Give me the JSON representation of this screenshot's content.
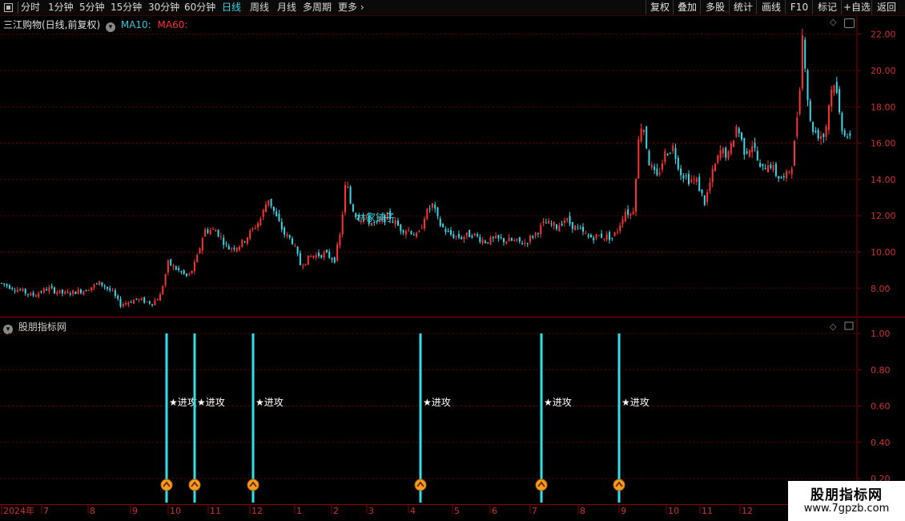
{
  "toolbar": {
    "periods": [
      {
        "label": "分时"
      },
      {
        "label": "1分钟"
      },
      {
        "label": "5分钟"
      },
      {
        "label": "15分钟"
      },
      {
        "label": "30分钟"
      },
      {
        "label": "60分钟"
      },
      {
        "label": "日线",
        "active": true
      },
      {
        "label": "周线"
      },
      {
        "label": "月线"
      },
      {
        "label": "多周期"
      },
      {
        "label": "更多"
      }
    ],
    "right_buttons": [
      "复权",
      "叠加",
      "多股",
      "统计",
      "画线",
      "F10",
      "标记",
      "+自选",
      "返回"
    ]
  },
  "main_chart": {
    "title": "三江购物(日线,前复权)",
    "ma10_label": "MA10:",
    "ma60_label": "MA60:",
    "overlay_label": "林家铺子",
    "y_ticks": [
      "22.00",
      "20.00",
      "18.00",
      "16.00",
      "14.00",
      "12.00",
      "10.00",
      "8.00"
    ],
    "colors": {
      "up": "#ff3232",
      "down": "#36d7e8",
      "ma10": "#35c8d8",
      "ma60": "#ff3030",
      "grid": "#6a0000"
    }
  },
  "indicator": {
    "title": "股朋指标网",
    "signal_label": "★进攻",
    "y_ticks": [
      "1.00",
      "0.80",
      "0.60",
      "0.40",
      "0.20"
    ],
    "signals": [
      {
        "date": "2024-09-30"
      },
      {
        "date": "2024-10-21"
      },
      {
        "date": "2024-12-03"
      },
      {
        "date": "2025-04-09"
      },
      {
        "date": "2025-07-08"
      },
      {
        "date": "2025-09-01"
      }
    ]
  },
  "time_axis": {
    "labels": [
      "2024年",
      "7",
      "8",
      "9",
      "10",
      "11",
      "12",
      "1",
      "2",
      "3",
      "4",
      "5",
      "6",
      "7",
      "8",
      "9",
      "10",
      "11",
      "12"
    ]
  },
  "chart_data": {
    "type": "candlestick",
    "title": "三江购物(日线,前复权)",
    "ylim": [
      6.4,
      23.0
    ],
    "x_labels": [
      "2024年",
      "7",
      "8",
      "9",
      "10",
      "11",
      "12",
      "1",
      "2",
      "3",
      "4",
      "5",
      "6",
      "7",
      "8",
      "9",
      "10",
      "11",
      "12"
    ],
    "series_points": [
      {
        "x": "2024-06",
        "close": 8.3
      },
      {
        "x": "2024-07",
        "close": 7.7
      },
      {
        "x": "2024-08",
        "close": 7.6
      },
      {
        "x": "2024-09",
        "close": 7.3
      },
      {
        "x": "2024-10",
        "close": 10.8
      },
      {
        "x": "2024-11",
        "close": 11.5
      },
      {
        "x": "2024-12",
        "close": 12.5
      },
      {
        "x": "2025-01",
        "close": 10.0
      },
      {
        "x": "2025-02",
        "close": 9.8
      },
      {
        "x": "2025-02",
        "close": 15.2
      },
      {
        "x": "2025-03",
        "close": 11.8
      },
      {
        "x": "2025-04",
        "close": 11.5
      },
      {
        "x": "2025-05",
        "close": 10.7
      },
      {
        "x": "2025-06",
        "close": 10.7
      },
      {
        "x": "2025-07",
        "close": 11.7
      },
      {
        "x": "2025-08",
        "close": 10.8
      },
      {
        "x": "2025-09",
        "close": 16.5
      },
      {
        "x": "2025-10",
        "close": 14.0
      },
      {
        "x": "2025-11",
        "close": 16.0
      },
      {
        "x": "2025-12",
        "close": 14.0
      },
      {
        "x": "2026-01",
        "close": 22.8
      },
      {
        "x": "2026-01",
        "close": 19.5
      },
      {
        "x": "2026-02",
        "close": 16.2
      }
    ]
  },
  "watermark": {
    "title": "股朋指标网",
    "url": "www.7gpzb.com"
  }
}
